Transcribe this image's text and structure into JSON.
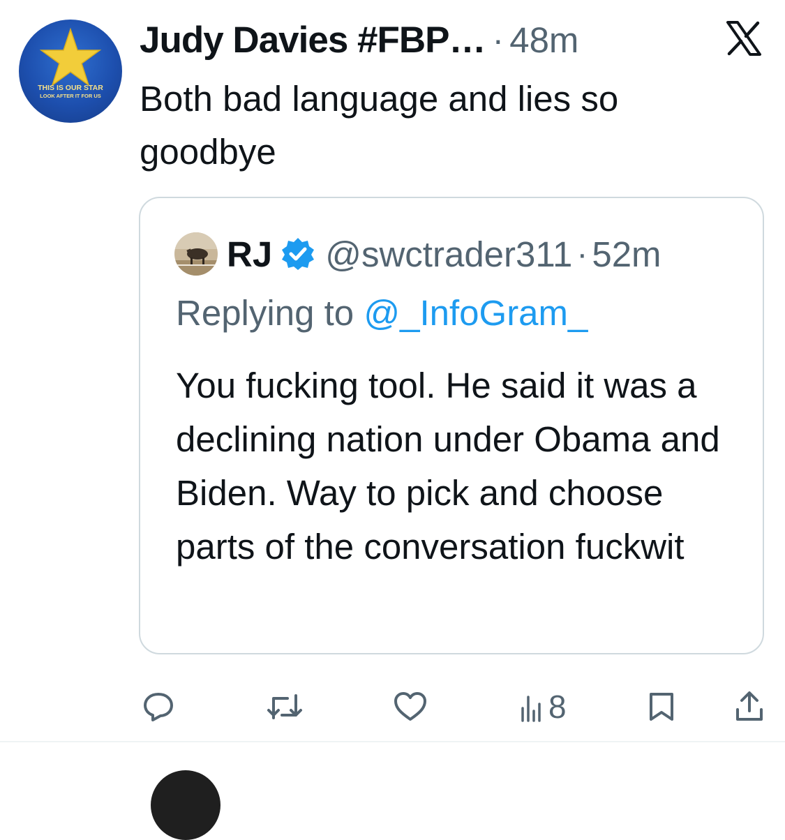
{
  "tweet": {
    "author": {
      "name": "Judy Davies #FBP…",
      "avatar_icon": "blue-star-avatar-icon",
      "avatar_caption_line1": "THIS IS OUR STAR",
      "avatar_caption_line2": "LOOK AFTER IT FOR US"
    },
    "separator": "·",
    "time": "48m",
    "text": "Both bad language and lies so goodbye",
    "platform_icon": "x-logo-icon"
  },
  "quoted_tweet": {
    "avatar_icon": "horse-photo-avatar-icon",
    "name": "RJ",
    "verified_icon": "verified-badge-icon",
    "handle": "@swctrader311",
    "separator": "·",
    "time": "52m",
    "replying_prefix": "Replying to ",
    "replying_mention": "@_InfoGram_",
    "text": "You fucking tool. He said it was a declining nation under Obama and Biden. Way to pick and choose parts of the conversation fuckwit"
  },
  "actions": {
    "reply_icon": "reply-icon",
    "retweet_icon": "retweet-icon",
    "like_icon": "like-icon",
    "views_icon": "views-icon",
    "views_count": "8",
    "bookmark_icon": "bookmark-icon",
    "share_icon": "share-icon"
  },
  "colors": {
    "text_primary": "#0f1419",
    "text_secondary": "#536471",
    "link": "#1d9bf0",
    "verified": "#1d9bf0",
    "border": "#cfd9de"
  }
}
